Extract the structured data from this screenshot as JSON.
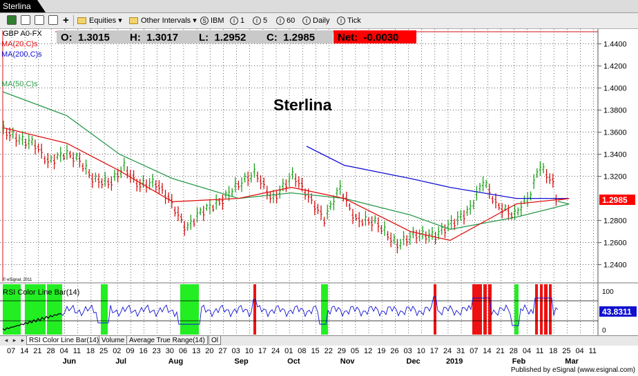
{
  "window": {
    "tab_title": "Sterlina"
  },
  "toolbar": {
    "equities_label": "Equities",
    "intervals_label": "Other Intervals",
    "buttons": [
      {
        "glyph": "S",
        "label": "IBM"
      },
      {
        "glyph": "I",
        "label": "1"
      },
      {
        "glyph": "I",
        "label": "5"
      },
      {
        "glyph": "I",
        "label": "60"
      },
      {
        "glyph": "I",
        "label": "Daily"
      },
      {
        "glyph": "I",
        "label": "Tick"
      }
    ]
  },
  "quote": {
    "symbol": "GBP A0-FX",
    "open": "O:  1.3015",
    "high": "H:  1.3017",
    "low": "L:  1.2952",
    "close": "C:  1.2985",
    "net": "Net:  -0.0030"
  },
  "chart": {
    "title": "Sterlina",
    "ma20_label": "MA(20,C)s",
    "ma200_label": "MA(200,C)s",
    "ma50_label": "MA(50,C)s",
    "copyright": "© eSignal, 2011",
    "last_price": "1.2985",
    "price_ticks": [
      "1.4400",
      "1.4200",
      "1.4000",
      "1.3800",
      "1.3600",
      "1.3400",
      "1.3200",
      "1.2800",
      "1.2600",
      "1.2400"
    ],
    "colors": {
      "up": "#1aa01a",
      "down": "#d01010",
      "ma20": "#e01010",
      "ma50": "#2a9a4a",
      "ma200": "#1010d0",
      "net_bg": "#ff0000"
    }
  },
  "rsi": {
    "label": "RSI Color Line Bar(14)",
    "value": "43.8311",
    "ticks": [
      "100",
      "0"
    ]
  },
  "xaxis": {
    "days": [
      "07",
      "14",
      "21",
      "28",
      "04",
      "11",
      "18",
      "25",
      "02",
      "09",
      "16",
      "23",
      "30",
      "06",
      "13",
      "20",
      "27",
      "03",
      "10",
      "17",
      "24",
      "01",
      "08",
      "15",
      "22",
      "29",
      "05",
      "12",
      "19",
      "26",
      "03",
      "10",
      "17",
      "24",
      "31",
      "07",
      "14",
      "21",
      "28",
      "04",
      "11",
      "18",
      "25",
      "04",
      "11"
    ],
    "months": [
      "Jun",
      "Jul",
      "Aug",
      "Sep",
      "Oct",
      "Nov",
      "Dec",
      "2019",
      "Feb",
      "Mar"
    ]
  },
  "bottom_tabs": [
    "RSI Color Line Bar(14)",
    "Volume",
    "Average True Range(14)",
    "Ol"
  ],
  "footer": "Published by eSignal (www.esignal.com)",
  "chart_data": {
    "type": "line",
    "title": "Sterlina",
    "series": [
      {
        "name": "MA(20,C)s",
        "x": [
          "Jun",
          "Jul",
          "Aug",
          "Sep",
          "Oct",
          "Nov",
          "Dec",
          "2019",
          "Feb",
          "Mar"
        ],
        "values": [
          1.35,
          1.325,
          1.297,
          1.3,
          1.31,
          1.3,
          1.27,
          1.262,
          1.295,
          1.3
        ]
      },
      {
        "name": "MA(50,C)s",
        "x": [
          "Jun",
          "Jul",
          "Aug",
          "Sep",
          "Oct",
          "Nov",
          "Dec",
          "2019",
          "Feb",
          "Mar"
        ],
        "values": [
          1.375,
          1.34,
          1.318,
          1.3,
          1.305,
          1.3,
          1.285,
          1.272,
          1.283,
          1.295
        ]
      },
      {
        "name": "MA(200,C)s",
        "x": [
          "Oct",
          "Nov",
          "Dec",
          "2019",
          "Feb",
          "Mar"
        ],
        "values": [
          1.346,
          1.33,
          1.318,
          1.31,
          1.3,
          1.3
        ]
      }
    ],
    "ylim": [
      1.23,
      1.46
    ]
  }
}
